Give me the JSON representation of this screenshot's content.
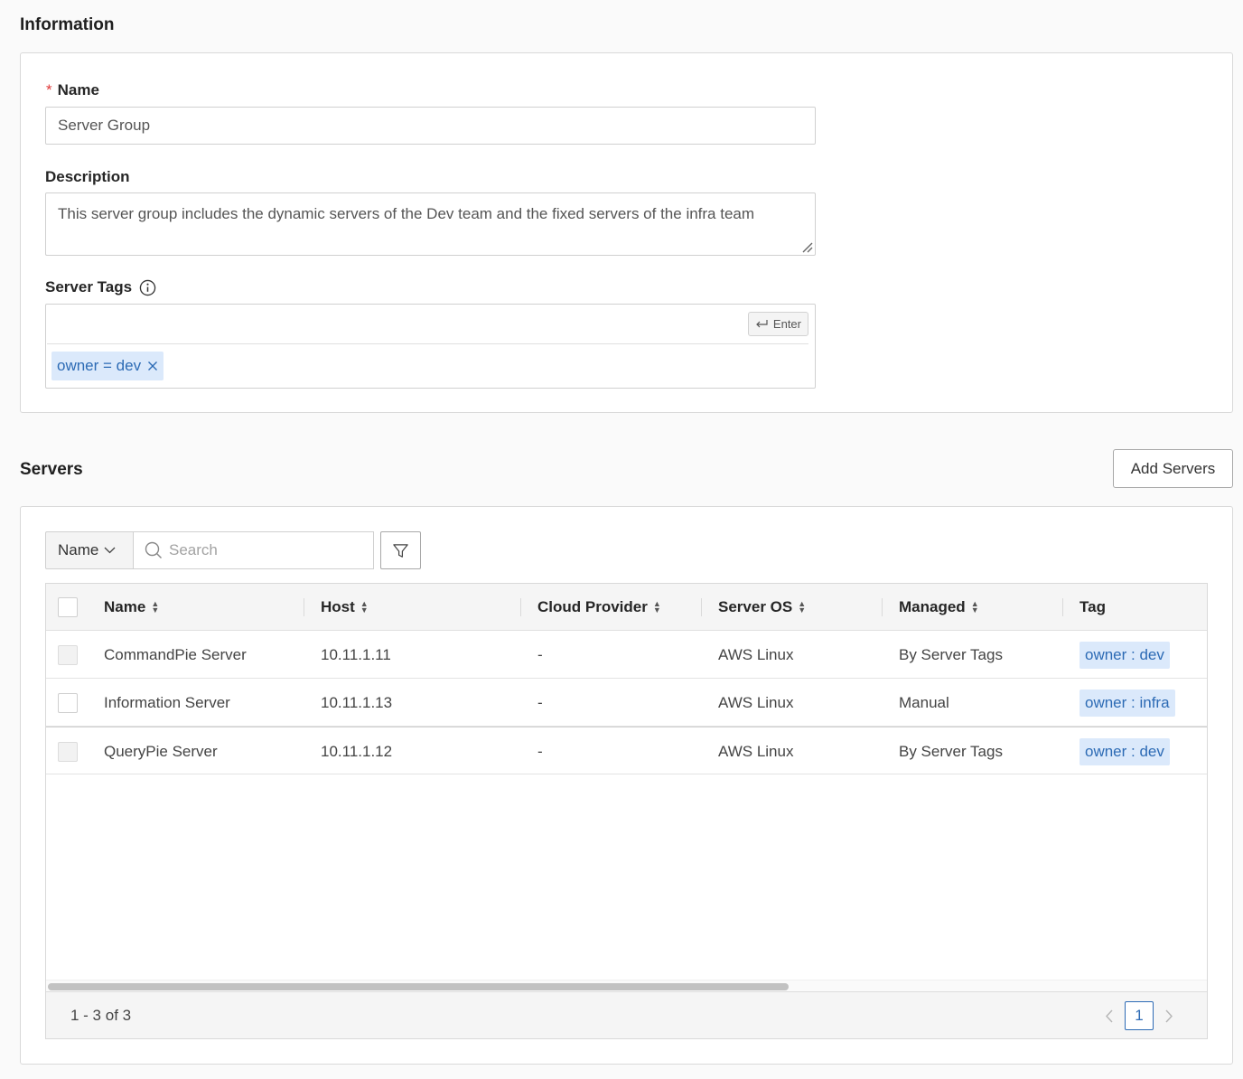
{
  "information": {
    "title": "Information",
    "name_label": "Name",
    "name_value": "Server Group",
    "description_label": "Description",
    "description_value": "This server group includes the dynamic servers of the Dev team and the fixed servers of the infra team",
    "server_tags_label": "Server Tags",
    "enter_label": "Enter",
    "tags": [
      "owner = dev"
    ]
  },
  "servers": {
    "title": "Servers",
    "add_button": "Add Servers",
    "filter_select": "Name",
    "search_placeholder": "Search",
    "columns": [
      "Name",
      "Host",
      "Cloud Provider",
      "Server OS",
      "Managed",
      "Tag"
    ],
    "rows": [
      {
        "name": "CommandPie Server",
        "host": "10.11.1.11",
        "cloud": "-",
        "os": "AWS Linux",
        "managed": "By Server Tags",
        "tag": "owner : dev",
        "checkbox_disabled": true
      },
      {
        "name": "Information Server",
        "host": "10.11.1.13",
        "cloud": "-",
        "os": "AWS Linux",
        "managed": "Manual",
        "tag": "owner : infra",
        "checkbox_disabled": false
      },
      {
        "name": "QueryPie Server",
        "host": "10.11.1.12",
        "cloud": "-",
        "os": "AWS Linux",
        "managed": "By Server Tags",
        "tag": "owner : dev",
        "checkbox_disabled": true
      }
    ],
    "pagination_summary": "1 - 3 of 3",
    "current_page": "1",
    "scroll_fraction": 0.64
  },
  "icons": {
    "info": "info-circle-icon",
    "enter": "enter-return-icon",
    "close": "close-icon",
    "search": "search-icon",
    "filter": "filter-icon",
    "chevron": "chevron-down-icon"
  },
  "colors": {
    "accent": "#2d6bb5",
    "tag_bg": "#dbe9fb",
    "required": "#e03a3a"
  }
}
